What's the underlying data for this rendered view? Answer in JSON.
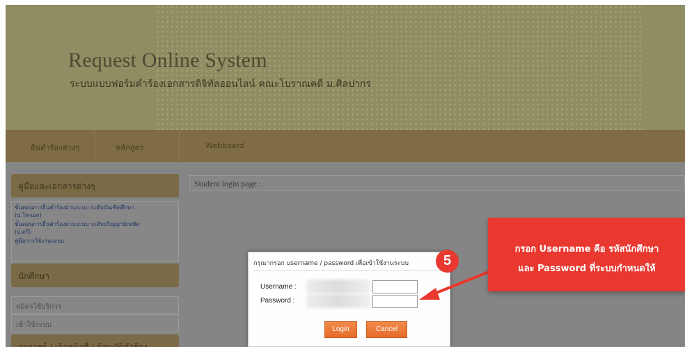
{
  "header": {
    "title": "Request Online System",
    "subtitle": "ระบบแบบฟอร์มคำร้องเอกสารดิจิทัลออนไลน์ คณะโบราณคดี ม.ศิลปากร"
  },
  "navbar": {
    "items": [
      {
        "label": "ยื่นคำร้องต่างๆ"
      },
      {
        "label": "หลักสูตร"
      },
      {
        "label": "Webboard"
      }
    ]
  },
  "sidebar": {
    "docs_heading": "คู่มือและเอกสารต่างๆ",
    "links": [
      {
        "label": "ขั้นตอนการยื่นคำร้องผ่านระบบ ระดับบัณฑิตศึกษา"
      },
      {
        "label": "(ป.โท-เอก)"
      },
      {
        "label": "ขั้นตอนการยื่นคำร้องผ่านระบบ ระดับปริญญาบัณฑิต"
      },
      {
        "label": "(ป.ตรี)"
      },
      {
        "label": "คู่มือการใช้งานระบบ"
      }
    ],
    "student_heading": "นักศึกษา",
    "student_items": [
      {
        "label": "สมัครใช้บริการ"
      },
      {
        "label": "เข้าใช้ระบบ"
      }
    ],
    "staff_heading": "อาจารย์ / เจ้าหน้าที่ / ผู้อนุมัติคำร้อง"
  },
  "main": {
    "title": "Student login page :"
  },
  "login_dialog": {
    "title": "กรุณากรอก username / password เพื่อเข้าใช้งานระบบ",
    "username_label": "Username :",
    "password_label": "Password :",
    "username_value": "",
    "password_value": "",
    "login_button": "Login",
    "cancel_button": "Cancel"
  },
  "annotation": {
    "step_number": "5",
    "line1": "กรอก Username คือ รหัสนักศึกษา",
    "line2": "และ Password ที่ระบบกำหนดให้",
    "color": "#e8382f"
  }
}
